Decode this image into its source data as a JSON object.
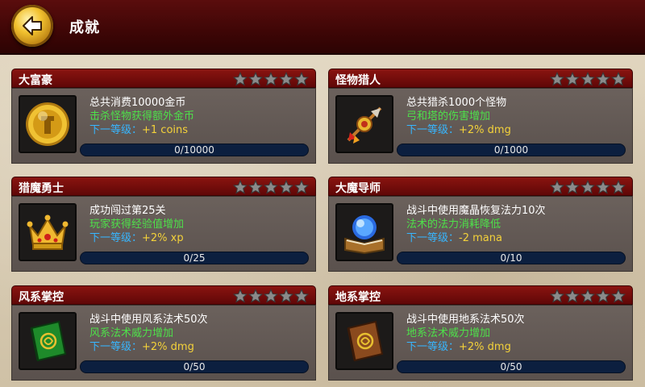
{
  "header": {
    "title": "成就",
    "back_icon": "back-arrow-icon"
  },
  "achievements": [
    {
      "title": "大富豪",
      "stars": 5,
      "desc": "总共消费10000金币",
      "bonus": "击杀怪物获得额外金币",
      "next_label": "下一等级：",
      "next_value": "+1  coins",
      "progress": "0/10000",
      "icon": "gold-coin-icon"
    },
    {
      "title": "怪物猎人",
      "stars": 5,
      "desc": "总共猎杀1000个怪物",
      "bonus": "弓和塔的伤害增加",
      "next_label": "下一等级：",
      "next_value": "+2%  dmg",
      "progress": "0/1000",
      "icon": "arrow-target-icon"
    },
    {
      "title": "猎魔勇士",
      "stars": 5,
      "desc": "成功闯过第25关",
      "bonus": "玩家获得经验值增加",
      "next_label": "下一等级：",
      "next_value": "+2%  xp",
      "progress": "0/25",
      "icon": "crown-icon"
    },
    {
      "title": "大魔导师",
      "stars": 5,
      "desc": "战斗中使用魔晶恢复法力10次",
      "bonus": "法术的法力消耗降低",
      "next_label": "下一等级：",
      "next_value": "-2  mana",
      "progress": "0/10",
      "icon": "crystal-book-icon"
    },
    {
      "title": "风系掌控",
      "stars": 5,
      "desc": "战斗中使用风系法术50次",
      "bonus": "风系法术威力增加",
      "next_label": "下一等级：",
      "next_value": "+2%  dmg",
      "progress": "0/50",
      "icon": "green-spellbook-icon"
    },
    {
      "title": "地系掌控",
      "stars": 5,
      "desc": "战斗中使用地系法术50次",
      "bonus": "地系法术威力增加",
      "next_label": "下一等级：",
      "next_value": "+2%  dmg",
      "progress": "0/50",
      "icon": "brown-spellbook-icon"
    }
  ],
  "colors": {
    "header": "#4a0909",
    "card_bar": "#7a100c",
    "bonus_text": "#4ee04a",
    "next_text": "#37b6ff",
    "value_text": "#f4d23a"
  }
}
